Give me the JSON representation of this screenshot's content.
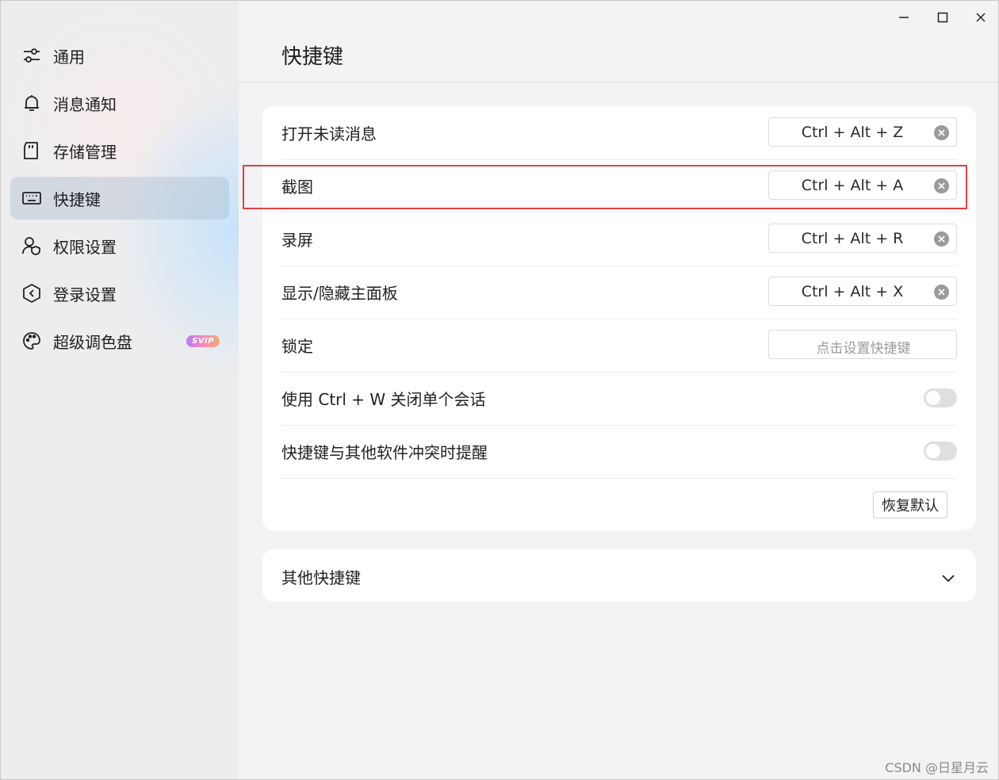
{
  "sidebar": {
    "items": [
      {
        "label": "通用",
        "icon": "sliders-icon"
      },
      {
        "label": "消息通知",
        "icon": "bell-icon"
      },
      {
        "label": "存储管理",
        "icon": "storage-card-icon"
      },
      {
        "label": "快捷键",
        "icon": "keyboard-icon",
        "active": true
      },
      {
        "label": "权限设置",
        "icon": "user-shield-icon"
      },
      {
        "label": "登录设置",
        "icon": "hexagon-shield-icon"
      },
      {
        "label": "超级调色盘",
        "icon": "palette-icon",
        "badge": "SVIP"
      }
    ]
  },
  "window": {
    "minimize_icon": "minimize-icon",
    "maximize_icon": "maximize-icon",
    "close_icon": "close-icon"
  },
  "main": {
    "title": "快捷键",
    "shortcuts": [
      {
        "label": "打开未读消息",
        "key": "Ctrl + Alt + Z"
      },
      {
        "label": "截图",
        "key": "Ctrl + Alt + A"
      },
      {
        "label": "录屏",
        "key": "Ctrl + Alt + R"
      },
      {
        "label": "显示/隐藏主面板",
        "key": "Ctrl + Alt + X"
      },
      {
        "label": "锁定",
        "placeholder": "点击设置快捷键"
      }
    ],
    "toggles": [
      {
        "label": "使用 Ctrl + W 关闭单个会话",
        "on": false
      },
      {
        "label": "快捷键与其他软件冲突时提醒",
        "on": false
      }
    ],
    "reset_label": "恢复默认",
    "other_section": {
      "label": "其他快捷键",
      "icon": "chevron-down-icon"
    }
  },
  "watermark": "CSDN @日星月云",
  "colors": {
    "highlight": "#e04040",
    "active_item": "#c4d3e0",
    "toggle_off": "#dfdfe2"
  }
}
